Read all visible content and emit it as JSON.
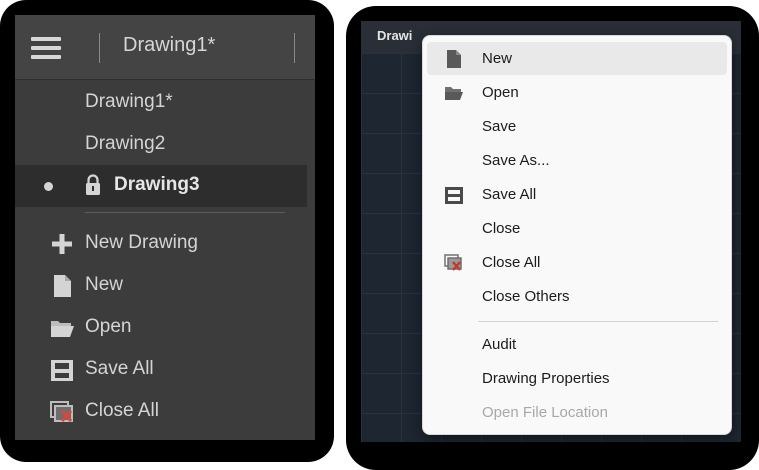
{
  "left_panel": {
    "header": {
      "title": "Drawing1*"
    },
    "documents": [
      "Drawing1*",
      "Drawing2"
    ],
    "active_document": "Drawing3",
    "actions": [
      {
        "label": "New Drawing",
        "icon": "plus-icon"
      },
      {
        "label": "New",
        "icon": "new-file-icon"
      },
      {
        "label": "Open",
        "icon": "folder-open-icon"
      },
      {
        "label": "Save All",
        "icon": "save-all-icon"
      },
      {
        "label": "Close All",
        "icon": "close-all-icon"
      }
    ]
  },
  "right_panel": {
    "tab_text": "Drawi",
    "context_menu": {
      "items": [
        {
          "label": "New",
          "icon": "new-file-icon",
          "hovered": true
        },
        {
          "label": "Open",
          "icon": "folder-open-icon"
        },
        {
          "label": "Save"
        },
        {
          "label": "Save As..."
        },
        {
          "label": "Save All",
          "icon": "save-all-icon"
        },
        {
          "label": "Close"
        },
        {
          "label": "Close All",
          "icon": "close-all-icon"
        },
        {
          "label": "Close Others"
        },
        {
          "label": "Audit"
        },
        {
          "label": "Drawing Properties"
        },
        {
          "label": "Open File Location",
          "disabled": true
        }
      ]
    }
  },
  "colors": {
    "left_panel_bg": "#3c3c3c",
    "left_text": "#d4d4d4",
    "menu_bg": "#f9f9f9",
    "menu_hover": "#e9e9e9",
    "menu_disabled_text": "#a8a8a8",
    "close_all_accent": "#c0392b"
  }
}
